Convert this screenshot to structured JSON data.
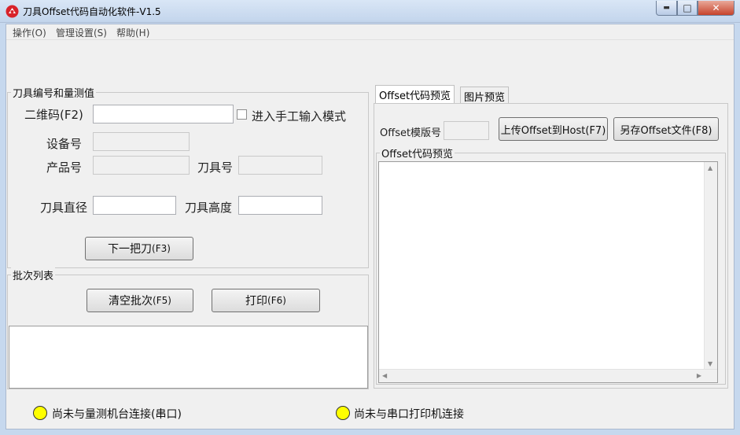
{
  "window": {
    "title": "刀具Offset代码自动化软件-V1.5",
    "min_glyph": "▬",
    "max_glyph": "□",
    "close_glyph": "✕"
  },
  "menu": [
    "操作(O)",
    "管理设置(S)",
    "帮助(H)"
  ],
  "tool_group": {
    "title": "刀具编号和量测值",
    "qr_label": "二维码(F2)",
    "qr_value": "",
    "manual_checkbox_label": "进入手工输入模式",
    "manual_checked": false,
    "device_label": "设备号",
    "product_label": "产品号",
    "tool_no_label": "刀具号",
    "diameter_label": "刀具直径",
    "height_label": "刀具高度",
    "next_button": {
      "text": "下一把刀",
      "key": "(F3)"
    }
  },
  "batch_group": {
    "title": "批次列表",
    "clear_button": {
      "text": "清空批次",
      "key": "(F5)"
    },
    "print_button": {
      "text": "打印",
      "key": "(F6)"
    }
  },
  "preview": {
    "tabs": [
      "Offset代码预览",
      "图片预览"
    ],
    "template_label": "Offset模版号",
    "upload_button": "上传Offset到Host(F7)",
    "save_button": "另存Offset文件(F8)",
    "code_group_title": "Offset代码预览"
  },
  "status": {
    "measure": "尚未与量测机台连接(串口)",
    "printer": "尚未与串口打印机连接",
    "led_color": "#ffff00"
  }
}
